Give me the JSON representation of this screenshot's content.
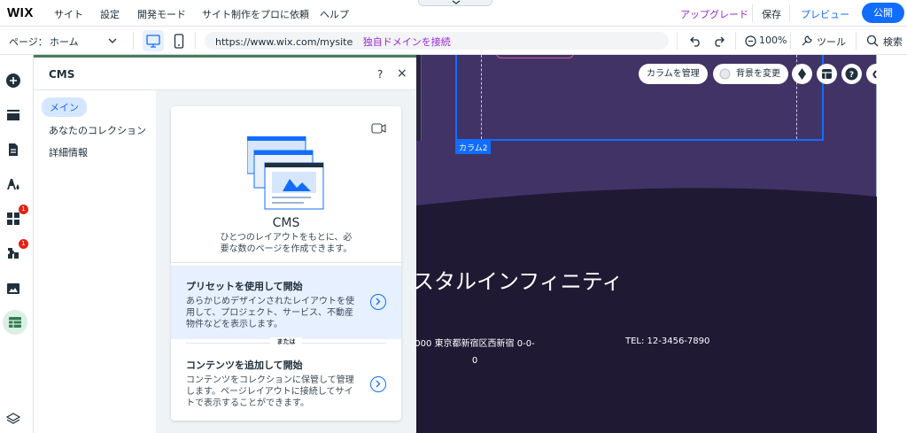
{
  "topbar": {
    "logo": "WIX",
    "menu": [
      "サイト",
      "設定",
      "開発モード",
      "サイト制作をプロに依頼",
      "ヘルプ"
    ],
    "upgrade": "アップグレード",
    "save": "保存",
    "preview": "プレビュー",
    "publish": "公開"
  },
  "toolbar": {
    "page_label": "ページ：",
    "page_name": "ホーム",
    "url": "https://www.wix.com/mysite",
    "connect_domain": "独自ドメインを接続",
    "zoom": "100%",
    "tools": "ツール",
    "search": "検索"
  },
  "sidebar": {
    "badges": [
      "1",
      "1"
    ]
  },
  "panel": {
    "title": "CMS",
    "help": "?",
    "close": "×",
    "nav": [
      "メイン",
      "あなたのコレクション",
      "詳細情報"
    ],
    "card": {
      "title": "CMS",
      "subtitle": "ひとつのレイアウトをもとに、必要な数のページを作成できます。",
      "option1_title": "プリセットを使用して開始",
      "option1_desc": "あらかじめデザインされたレイアウトを使用して、プロジェクト、サービス、不動産物件などを表示します。",
      "divider": "または",
      "option2_title": "コンテンツを追加して開始",
      "option2_desc": "コンテンツをコレクションに保管して管理します。ページレイアウトに接続してサイトで表示することができます。"
    }
  },
  "canvas": {
    "manage_columns": "カラムを管理",
    "change_bg": "背景を変更",
    "column_tag": "カラム2",
    "heading": "スタルインフィニティ",
    "address": "000 東京都新宿区西新宿 0-0-0",
    "phone": "TEL: 12-3456-7890"
  },
  "colors": {
    "accent": "#116dff",
    "upgrade": "#9a27d5",
    "section_purple": "#413366",
    "footer": "#1f1934"
  }
}
